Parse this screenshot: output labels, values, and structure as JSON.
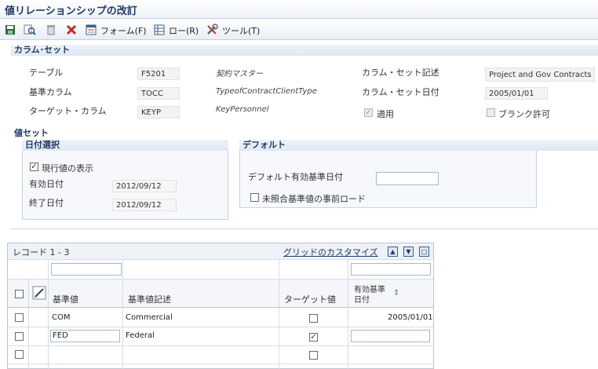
{
  "title": "値リレーションシップの改訂",
  "toolbar": {
    "form_label": "フォーム(F)",
    "row_label": "ロー(R)",
    "tools_label": "ツール(T)"
  },
  "column_set": {
    "section_title": "カラム･セット",
    "table_label": "テーブル",
    "table_value": "F5201",
    "table_desc": "契約マスター",
    "base_column_label": "基準カラム",
    "base_column_value": "TOCC",
    "base_column_desc": "TypeofContractClientType",
    "target_column_label": "ターゲット・カラム",
    "target_column_value": "KEYP",
    "target_column_desc": "KeyPersonnel",
    "desc_label": "カラム・セット記述",
    "desc_value": "Project and Gov Contracts",
    "date_label": "カラム・セット日付",
    "date_value": "2005/01/01",
    "apply_label": "適用",
    "apply_checked": true,
    "allow_blank_label": "ブランク許可",
    "allow_blank_checked": false
  },
  "value_set": {
    "section_title": "値セット",
    "date_select": {
      "title": "日付選択",
      "show_current_label": "現行値の表示",
      "show_current_checked": true,
      "effective_date_label": "有効日付",
      "effective_date_value": "2012/09/12",
      "end_date_label": "終了日付",
      "end_date_value": "2012/09/12"
    },
    "defaults": {
      "title": "デフォルト",
      "default_effective_date_label": "デフォルト有効基準日付",
      "default_effective_date_value": "",
      "preload_label": "未照合基準値の事前ロード",
      "preload_checked": false
    }
  },
  "grid": {
    "records_label": "レコード 1 - 3",
    "customize_link": "グリッドのカスタマイズ",
    "columns": {
      "base_value": "基準値",
      "base_value_desc": "基準値記述",
      "target_value": "ターゲット値",
      "effective_date_line1": "有効基準",
      "effective_date_line2": "日付"
    },
    "rows": [
      {
        "base_value": "COM",
        "desc": "Commercial",
        "target_checked": false,
        "effective_date": "2005/01/01"
      },
      {
        "base_value": "FED",
        "desc": "Federal",
        "target_checked": true,
        "effective_date": ""
      },
      {
        "base_value": "",
        "desc": "",
        "target_checked": false,
        "effective_date": ""
      }
    ]
  },
  "colors": {
    "title": "#1f3a66",
    "section_bg": "#dfe8f2",
    "readonly_bg": "#f3f3f3"
  }
}
